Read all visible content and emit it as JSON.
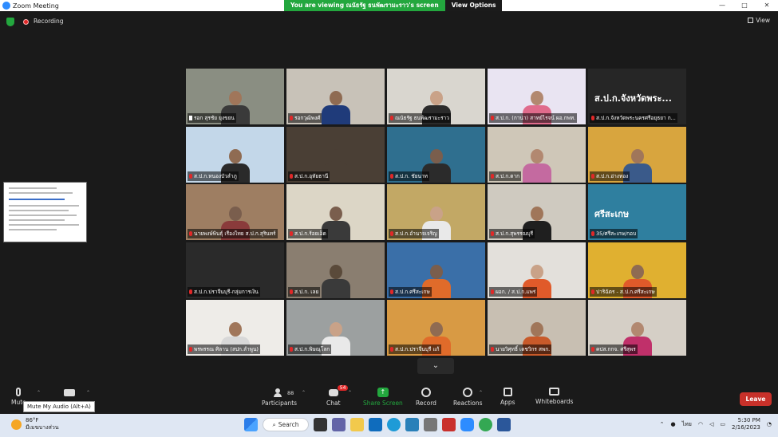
{
  "window": {
    "title": "Zoom Meeting",
    "controls": [
      "—",
      "□",
      "✕"
    ]
  },
  "share_banner": {
    "message": "You are viewing ณนัธรัฐ ธนพัฒรามะราว's screen",
    "option": "View Options"
  },
  "topbar": {
    "recording_label": "Recording",
    "view_label": "View"
  },
  "tiles": [
    {
      "name": "รอก สุรชัย ยุงขยน",
      "pinned": true,
      "bg": "#8a8e82",
      "skin": "#a0765a",
      "shirt": "#3a3a3a"
    },
    {
      "name": "รอกวุฒิพงศ์",
      "bg": "#c8c2b8",
      "skin": "#8f6b52",
      "shirt": "#1f3b7a"
    },
    {
      "name": "ณนัธรัฐ ธนพัฒรามะราว",
      "bg": "#d9d6cf",
      "skin": "#c9a288",
      "shirt": "#2b2b2b"
    },
    {
      "name": "ส.ป.ก. (กาน่า) สาทย์ไรจน์ ผอ.กพท.",
      "bg": "#e9e4f2",
      "skin": "#b28870",
      "shirt": "#e06b8c",
      "active": true
    },
    {
      "name": "ส.ป.ก.จังหวัดพระนครศรีอยุธยา ก...",
      "bg": "#262626",
      "big_text": "ส.ป.ก.จังหวัดพระ..."
    },
    {
      "name": "ส.ป.ก.หนองบัวลำภู",
      "bg": "#c3d7e9",
      "skin": "#8f6b52",
      "shirt": "#2a2a2a"
    },
    {
      "name": "ส.ป.ก.อุทัยธานี",
      "bg": "#4a3f35",
      "skin": "#4a3f35",
      "shirt": "#4a3f35"
    },
    {
      "name": "ส.ป.ก. ชัยนาท",
      "bg": "#2f6f8f",
      "skin": "#7a5e4d",
      "shirt": "#2b2b2b"
    },
    {
      "name": "ส.ป.ก.ตาก",
      "bg": "#cfc7b8",
      "skin": "#b28870",
      "shirt": "#c46aa0"
    },
    {
      "name": "ส.ป.ก.อ่างทอง",
      "bg": "#d8a53e",
      "skin": "#a0765a",
      "shirt": "#3a5a8a"
    },
    {
      "name": "นายพงษ์พินธุ์ เรืองไทย ส.ป.ก.สุรินทร์",
      "bg": "#9e7e62",
      "skin": "#7a5e4d",
      "shirt": "#8a3b3b"
    },
    {
      "name": "ส.ป.ก.ร้อยเอ็ด",
      "bg": "#dcd6c6",
      "skin": "#7a5e4d",
      "shirt": "#3a3a3a"
    },
    {
      "name": "ส.ป.ก.อำนาจเจริญ",
      "bg": "#c2a865",
      "skin": "#c9a288",
      "shirt": "#e9e9e9"
    },
    {
      "name": "ส.ป.ก.สุพรรณบุรี",
      "bg": "#cfcac0",
      "skin": "#a0765a",
      "shirt": "#1f1f1f"
    },
    {
      "name": "35/ศรีสะเกษ/กอบ",
      "bg": "#2f7f9f",
      "big_text": "ศรีสะเกษ"
    },
    {
      "name": "ส.ป.ก.ปราจีนบุรี-กลุ่มการเงิน",
      "bg": "#2a2a2a",
      "skin": "#2a2a2a",
      "shirt": "#2a2a2a"
    },
    {
      "name": "ส.ป.ก. เลย",
      "bg": "#8a7e70",
      "skin": "#5a4a3a",
      "shirt": "#3a3a3a"
    },
    {
      "name": "ส.ป.ก.ศรีสะเกษ",
      "bg": "#3a6fa8",
      "skin": "#7a5e4d",
      "shirt": "#e06b2a"
    },
    {
      "name": "ผอก. / ส.ป.ก.แพร่",
      "bg": "#e3e0db",
      "skin": "#c9a288",
      "shirt": "#e05a2a"
    },
    {
      "name": "ปาริฉัตร - ส.ป.ก.ศรีสะเกษ",
      "bg": "#e0b030",
      "skin": "#8f6b52",
      "shirt": "#e05a2a"
    },
    {
      "name": "พรพรรณ  ศิลาน (สปก.ลำพูน)",
      "bg": "#eeece8",
      "skin": "#a0765a",
      "shirt": "#d8d8d8"
    },
    {
      "name": "ส.ป.ก.พิษณุโลก",
      "bg": "#9ca0a0",
      "skin": "#c9a288",
      "shirt": "#e9e9e9"
    },
    {
      "name": "ส.ป.ก.ปราจีนบุรี แก้",
      "bg": "#d89a44",
      "skin": "#8f6b52",
      "shirt": "#e06b2a"
    },
    {
      "name": "นายวิศุทธิ์ เดชวิกร สพก.",
      "bg": "#c8bfb2",
      "skin": "#a0765a",
      "shirt": "#c85a2a"
    },
    {
      "name": "คปส.กกจ. ศรีสุพร",
      "bg": "#d5cfc6",
      "skin": "#b28870",
      "shirt": "#c0306a"
    }
  ],
  "toolbar": {
    "mute_label": "Mute",
    "mute_tooltip": "Mute My Audio (Alt+A)",
    "participants_label": "Participants",
    "participants_count": "88",
    "chat_label": "Chat",
    "chat_badge": "54",
    "share_label": "Share Screen",
    "record_label": "Record",
    "reactions_label": "Reactions",
    "apps_label": "Apps",
    "whiteboards_label": "Whiteboards",
    "leave_label": "Leave"
  },
  "taskbar": {
    "temperature": "86°F",
    "weather_desc": "มีเมฆบางส่วน",
    "search_label": "Search",
    "lang": "ไทย",
    "time": "5:30 PM",
    "date": "2/16/2023"
  },
  "colors": {
    "accent_green": "#23a73e",
    "leave_red": "#c8312a",
    "active_speaker": "#c8d94a"
  }
}
